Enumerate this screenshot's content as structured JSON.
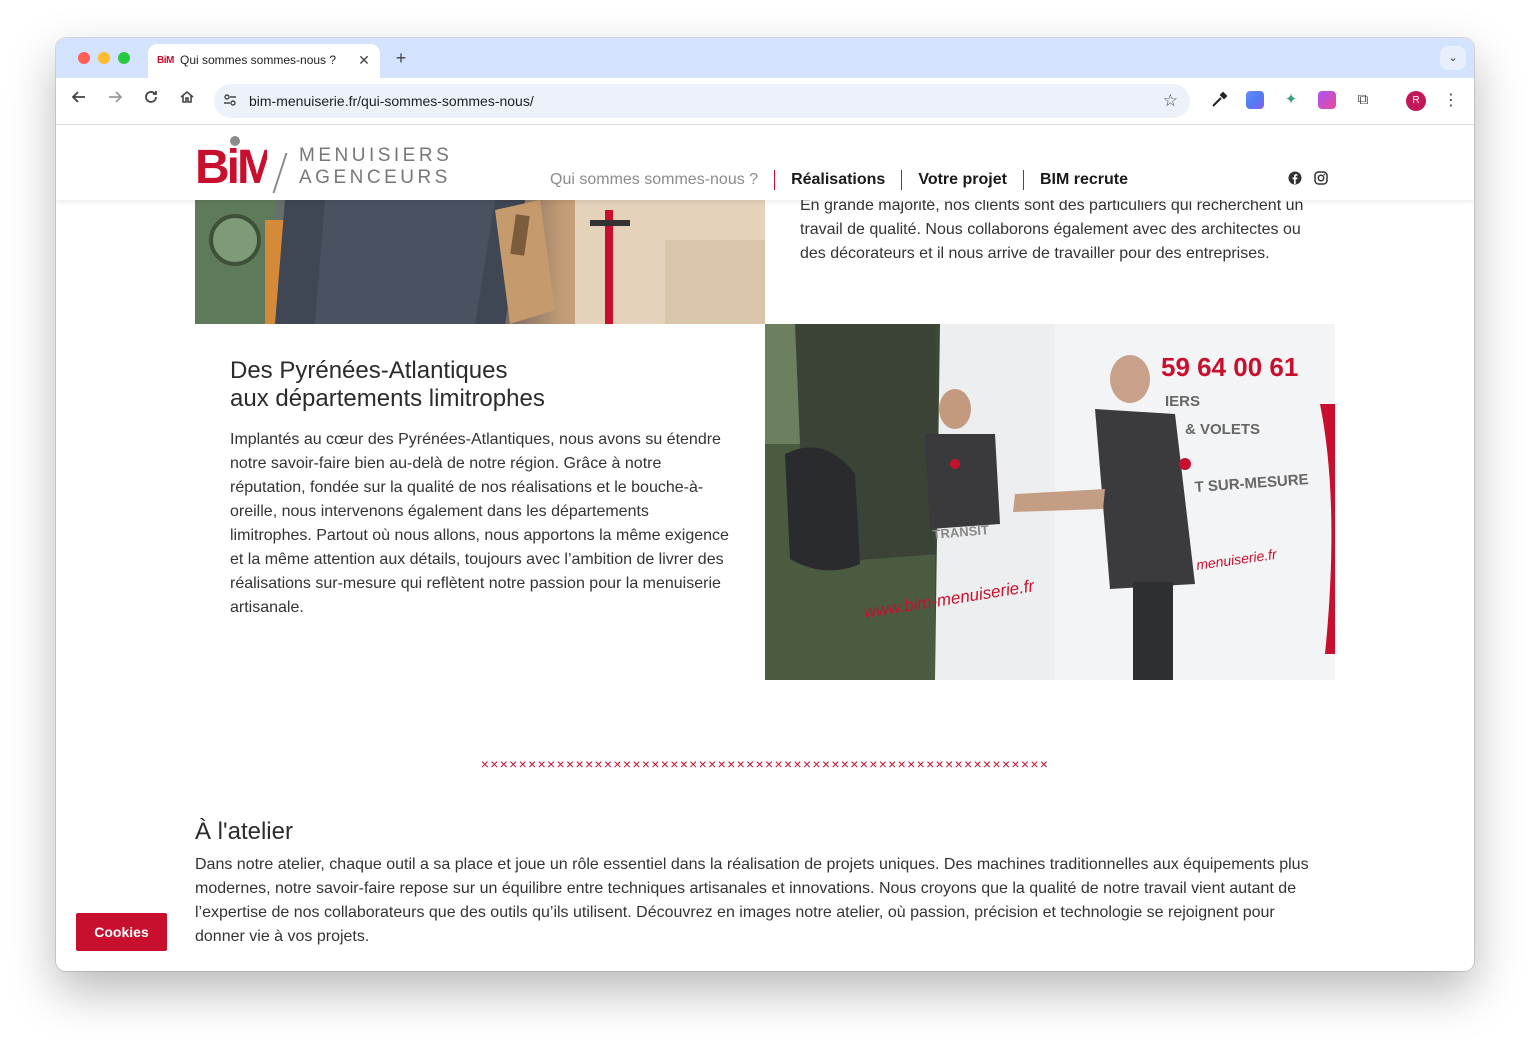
{
  "browser": {
    "tab_title": "Qui sommes sommes-nous ?",
    "tab_favicon_text": "BiM",
    "url": "bim-menuiserie.fr/qui-sommes-sommes-nous/",
    "avatar_letter": "R"
  },
  "site": {
    "logo_text": "BiM",
    "logo_line1": "MENUISIERS",
    "logo_line2": "AGENCEURS",
    "nav": [
      "Qui sommes sommes-nous ?",
      "Réalisations",
      "Votre projet",
      "BIM recrute"
    ],
    "social": [
      "facebook",
      "instagram"
    ]
  },
  "content": {
    "intro_paragraph": "En grande majorité, nos clients sont des particuliers qui recherchent un travail de qualité. Nous collaborons également avec des architectes ou des décorateurs et il nous arrive de travailler pour des entreprises.",
    "section_title_line1": "Des Pyrénées-Atlantiques",
    "section_title_line2": "aux départements limitrophes",
    "section_body": "Implantés au cœur des Pyrénées-Atlantiques, nous avons su étendre notre savoir-faire bien au-delà de notre région. Grâce à notre réputation, fondée sur la qualité de nos réalisations et le bouche-à-oreille, nous intervenons également dans les départements limitrophes. Partout où nous allons, nous apportons la même exigence et la même attention aux détails, toujours avec l’ambition de livrer des réalisations sur-mesure qui reflètent notre passion pour la menuiserie artisanale.",
    "van_phone": "59 64 00 61",
    "van_line1": "IERS",
    "van_line2": "& VOLETS",
    "van_line3": "T SUR-MESURE",
    "van_url_main": "www.bim-menuiserie.fr",
    "van_url_back": "menuiserie.fr",
    "van_transit": "TRANSIT",
    "divider": "××××××××××××××××××××××××××××××××××××××××××××××××××××××××××××",
    "atelier_title": "À l'atelier",
    "atelier_body": "Dans notre atelier, chaque outil a sa place et joue un rôle essentiel dans la réalisation de projets uniques. Des machines traditionnelles aux équipements plus modernes, notre savoir-faire repose sur un équilibre entre techniques artisanales et innovations. Nous croyons que la qualité de notre travail vient autant de l’expertise de nos collaborateurs que des outils qu’ils utilisent. Découvrez en images notre atelier, où passion, précision et technologie se rejoignent pour donner vie à vos projets."
  },
  "cookies_button": "Cookies",
  "colors": {
    "brand_red": "#c8102e",
    "tabstrip": "#d3e3fd"
  }
}
